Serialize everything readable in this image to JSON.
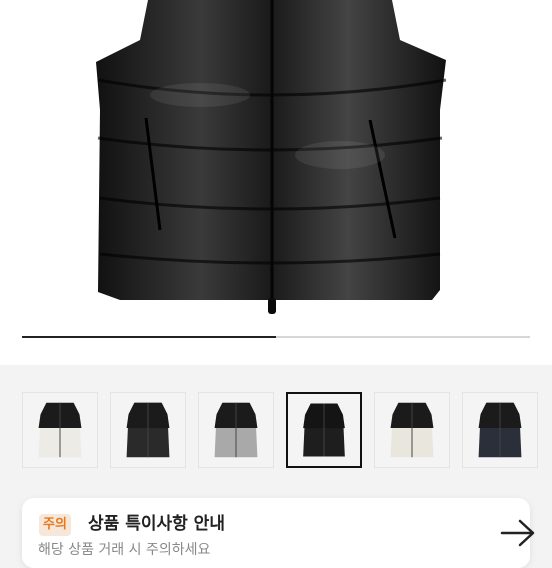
{
  "product_gallery": {
    "main_image": "black-puffer-vest-photo",
    "carousel_progress": 0.5,
    "thumbnails": [
      {
        "name": "white-black-vest",
        "body": "#ecebe6",
        "yoke": "#1b1b1b"
      },
      {
        "name": "black-vest",
        "body": "#2a2a2a",
        "yoke": "#1b1b1b"
      },
      {
        "name": "grey-black-vest",
        "body": "#a9a9a9",
        "yoke": "#1b1b1b"
      },
      {
        "name": "black-vest-selected",
        "body": "#1e1e1e",
        "yoke": "#141414",
        "selected": true
      },
      {
        "name": "cream-black-vest",
        "body": "#e8e6dd",
        "yoke": "#1b1b1b"
      },
      {
        "name": "navy-black-vest",
        "body": "#2b2f3a",
        "yoke": "#1b1b1b"
      }
    ]
  },
  "notice": {
    "badge": "주의",
    "title": "상품 특이사항 안내",
    "subtitle": "해당 상품 거래 시 주의하세요",
    "icon": "arrow-right-icon"
  },
  "colors": {
    "badge_bg": "#f7e7d9",
    "badge_text": "#e7781e",
    "progress": "#222222"
  }
}
